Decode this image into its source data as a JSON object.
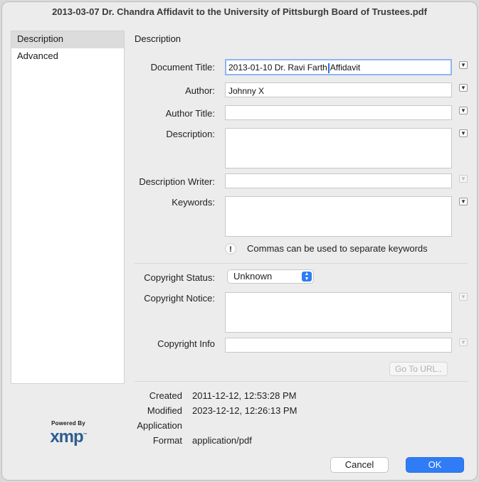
{
  "window": {
    "title": "2013-03-07 Dr. Chandra Affidavit to the University of Pittsburgh Board of Trustees.pdf"
  },
  "sidebar": {
    "items": [
      {
        "label": "Description",
        "selected": true
      },
      {
        "label": "Advanced",
        "selected": false
      }
    ]
  },
  "main": {
    "section_title": "Description",
    "fields": {
      "document_title": {
        "label": "Document Title:",
        "value_before_caret": "2013-01-10 Dr. Ravi Farth",
        "value_after_caret": "Affidavit"
      },
      "author": {
        "label": "Author:",
        "value": "Johnny X"
      },
      "author_title": {
        "label": "Author Title:",
        "value": ""
      },
      "description": {
        "label": "Description:",
        "value": ""
      },
      "description_writer": {
        "label": "Description Writer:",
        "value": ""
      },
      "keywords": {
        "label": "Keywords:",
        "value": ""
      }
    },
    "keywords_hint": "Commas can be used to separate keywords",
    "hint_icon": "!",
    "copyright": {
      "status_label": "Copyright Status:",
      "status_value": "Unknown",
      "notice_label": "Copyright Notice:",
      "info_label": "Copyright Info",
      "goto_url_label": "Go To URL.."
    },
    "metadata": {
      "created_label": "Created",
      "created_value": "2011-12-12, 12:53:28 PM",
      "modified_label": "Modified",
      "modified_value": "2023-12-12, 12:26:13 PM",
      "application_label": "Application",
      "application_value": "",
      "format_label": "Format",
      "format_value": "application/pdf"
    }
  },
  "logo": {
    "top": "Powered By",
    "main": "xmp",
    "tm": "™"
  },
  "buttons": {
    "cancel": "Cancel",
    "ok": "OK"
  },
  "colors": {
    "accent": "#2f7cf6",
    "logo": "#2d5d8f",
    "focus_ring": "#8fb6ee"
  },
  "icons": {
    "dropdown": "chevron-down-icon",
    "popup": "up-down-arrows-icon",
    "info": "exclamation-icon"
  }
}
